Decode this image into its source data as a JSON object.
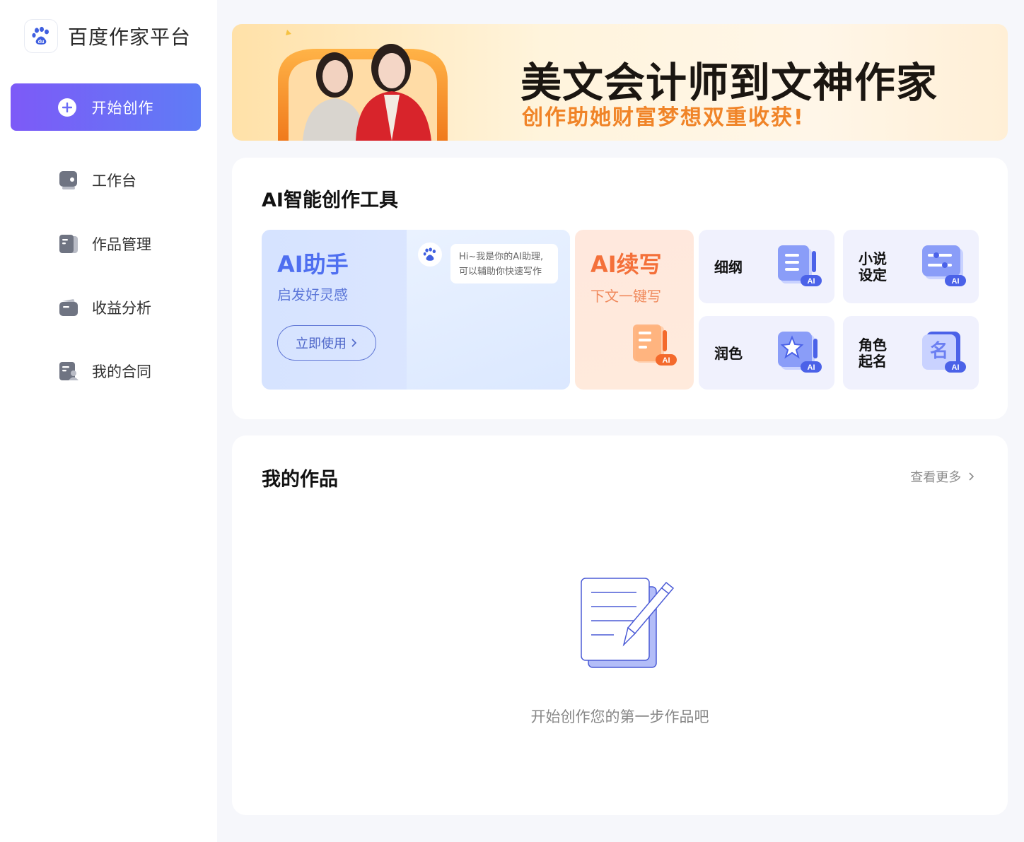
{
  "sidebar": {
    "brand": "百度作家平台",
    "start_button": "开始创作",
    "items": [
      {
        "label": "工作台",
        "icon": "dashboard-icon"
      },
      {
        "label": "作品管理",
        "icon": "works-icon"
      },
      {
        "label": "收益分析",
        "icon": "wallet-icon"
      },
      {
        "label": "我的合同",
        "icon": "contract-icon"
      }
    ]
  },
  "banner": {
    "title": "美文会计师到文神作家",
    "subtitle": "创作助她财富梦想双重收获!"
  },
  "tools": {
    "title": "AI智能创作工具",
    "assistant": {
      "title": "AI助手",
      "subtitle": "启发好灵感",
      "button": "立即使用",
      "bubble_line1": "Hi~我是你的AI助理,",
      "bubble_line2": "可以辅助你快速写作"
    },
    "continue": {
      "title": "AI续写",
      "subtitle": "下文一键写"
    },
    "outline": "细纲",
    "novel_setting_1": "小说",
    "novel_setting_2": "设定",
    "polish": "润色",
    "naming_1": "角色",
    "naming_2": "起名",
    "ai_badge": "AI"
  },
  "works": {
    "title": "我的作品",
    "more": "查看更多",
    "empty": "开始创作您的第一步作品吧"
  },
  "colors": {
    "accent": "#5f7cf6",
    "accent_purple": "#7d5af7",
    "orange": "#f4703a"
  }
}
